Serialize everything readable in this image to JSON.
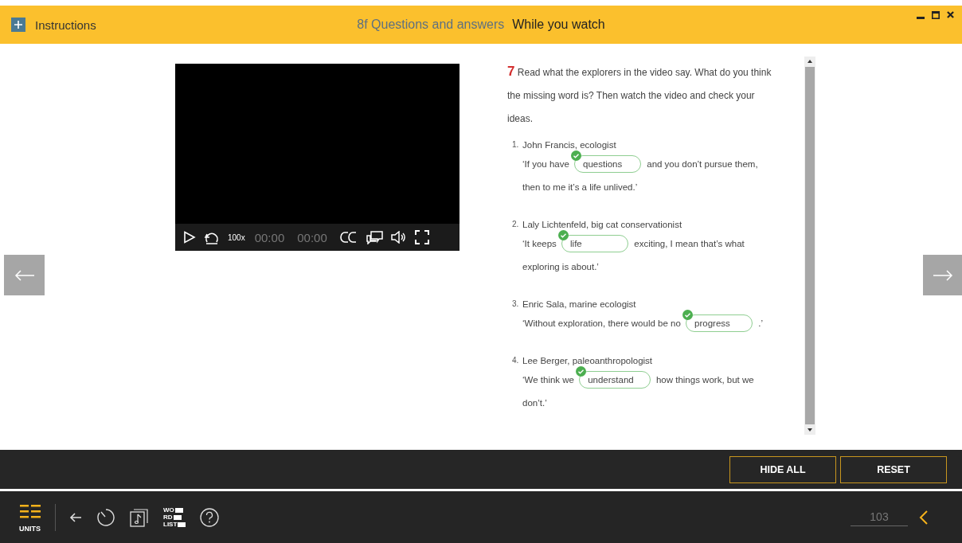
{
  "header": {
    "instructions": "Instructions",
    "unit": "8f Questions and answers",
    "section": "While you watch"
  },
  "video": {
    "speed": "100x",
    "current_time": "00:00",
    "duration": "00:00"
  },
  "exercise": {
    "number": "7",
    "instruction": "Read what the explorers in the video say. What do you think the missing word is? Then watch the video and check your ideas.",
    "items": [
      {
        "number": "1.",
        "speaker": "John Francis, ecologist",
        "before": "‘If you have",
        "answer": "questions",
        "correct": true,
        "after": "and you don’t pursue them,",
        "next_line": "then to me it’s a life unlived.’"
      },
      {
        "number": "2.",
        "speaker": "Laly Lichtenfeld, big cat conservationist",
        "before": "‘It keeps",
        "answer": "life",
        "correct": true,
        "after": "exciting, I mean that’s what",
        "next_line": "exploring is about.’"
      },
      {
        "number": "3.",
        "speaker": "Enric Sala, marine ecologist",
        "before": "‘Without exploration, there would be no",
        "answer": "progress",
        "correct": true,
        "after": ".’"
      },
      {
        "number": "4.",
        "speaker": "Lee Berger, paleoanthropologist",
        "before": "‘We think we",
        "answer": "understand",
        "correct": true,
        "after": "how things work, but we",
        "next_line": "don’t.’"
      }
    ]
  },
  "actions": [
    "HIDE ALL",
    "RESET"
  ],
  "bottom_bar": {
    "units_label": "UNITS",
    "word_list_icon": [
      "WO",
      "RD",
      "LIST"
    ],
    "page": "103"
  }
}
